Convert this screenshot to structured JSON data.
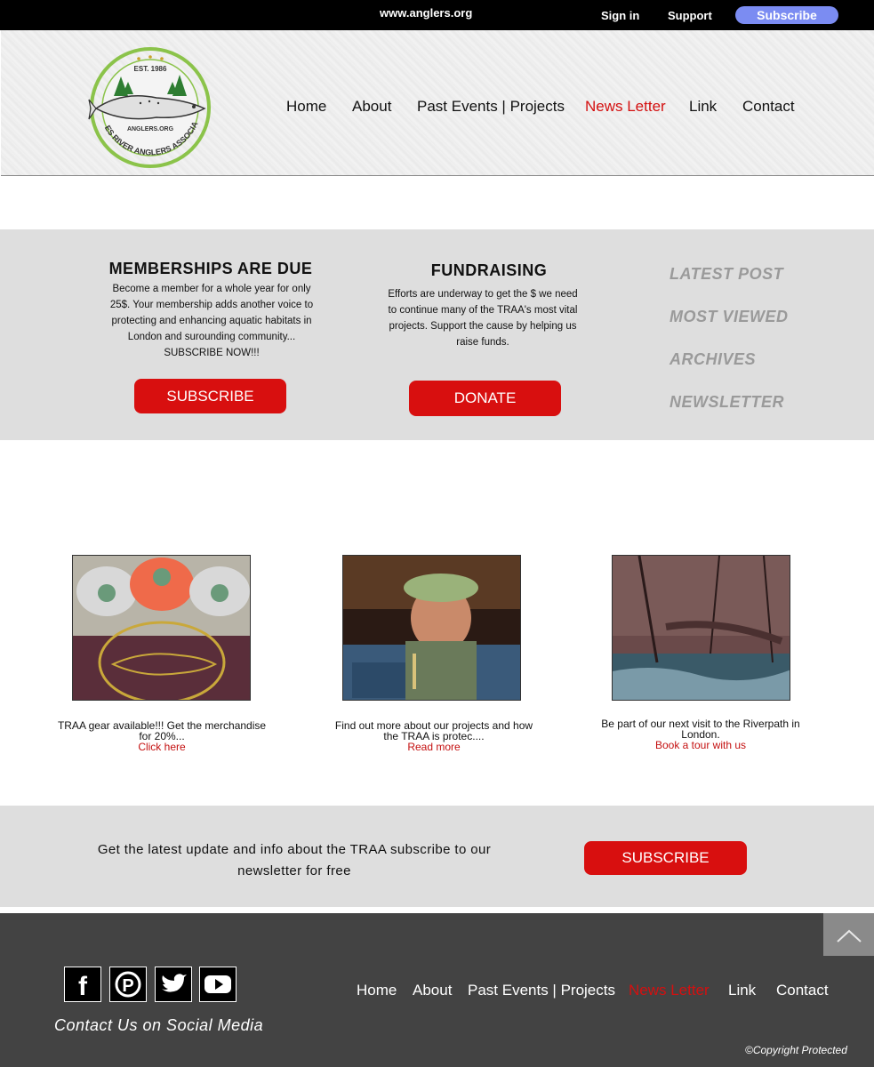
{
  "topbar": {
    "url": "www.anglers.org",
    "sign_in": "Sign in",
    "support": "Support",
    "subscribe": "Subscribe"
  },
  "logo": {
    "est": "EST. 1986",
    "site": "ANGLERS.ORG",
    "name": "THAMES RIVER ANGLERS ASSOCIATION"
  },
  "nav": {
    "items": [
      {
        "label": "Home"
      },
      {
        "label": "About"
      },
      {
        "label": "Past Events | Projects"
      },
      {
        "label": "News Letter"
      },
      {
        "label": "Link"
      },
      {
        "label": "Contact"
      }
    ],
    "active": "News Letter"
  },
  "promo": {
    "membership": {
      "title": "MEMBERSHIPS ARE DUE",
      "text": "Become a member for a whole year for only 25$. Your membership adds another voice to protecting and enhancing aquatic habitats in London and surounding community... SUBSCRIBE NOW!!!",
      "button": "SUBSCRIBE"
    },
    "fundraising": {
      "title": "FUNDRAISING",
      "text": "Efforts are underway to get the $ we need to continue many of the TRAA's most vital projects. Support the cause by helping us raise funds.",
      "button": "DONATE"
    },
    "side_links": [
      "LATEST POST",
      "MOST VIEWED",
      "ARCHIVES",
      "NEWSLETTER"
    ]
  },
  "cards": [
    {
      "text": "TRAA gear available!!! Get the merchandise for 20%...",
      "link": "Click here",
      "image": "traa-merchandise-caps-shirt"
    },
    {
      "text": "Find out more about our projects and how the TRAA is protec....",
      "link": "Read more",
      "image": "angler-inspecting-fish-hatchery"
    },
    {
      "text": "Be part of our next visit to the Riverpath in London.",
      "link": "Book a tour with us",
      "image": "riverpath-stream-woods"
    }
  ],
  "strip": {
    "text": "Get the latest update and info about the TRAA subscribe to our newsletter for free",
    "button": "SUBSCRIBE"
  },
  "footer": {
    "social_label": "Contact Us on Social Media",
    "social_icons": [
      "facebook-icon",
      "pinterest-icon",
      "twitter-icon",
      "youtube-icon"
    ],
    "copyright": "©Copyright Protected"
  },
  "colors": {
    "accent_red": "#d80f0f",
    "subscribe_blue": "#7b8cf2",
    "footer_bg": "#434343",
    "band_gray": "#dedede"
  }
}
